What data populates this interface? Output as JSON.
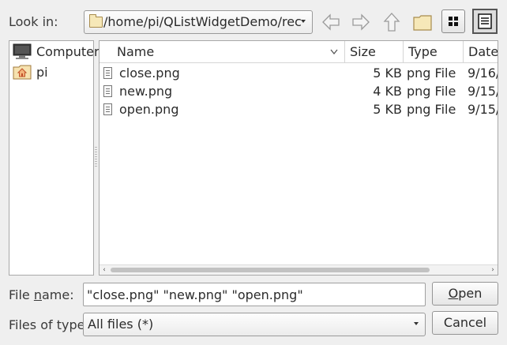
{
  "look_in": {
    "label": "Look in:",
    "path": "/home/pi/QListWidgetDemo/rec"
  },
  "toolbar": {
    "back_icon": "arrow-left-icon",
    "forward_icon": "arrow-right-icon",
    "parent_icon": "arrow-up-icon",
    "new_folder_icon": "new-folder-icon",
    "list_view_icon": "grid-icon",
    "detail_view_icon": "detail-list-icon"
  },
  "sidebar": {
    "items": [
      {
        "label": "Computer",
        "icon": "computer-icon"
      },
      {
        "label": "pi",
        "icon": "home-folder-icon"
      }
    ]
  },
  "file_list": {
    "columns": [
      "Name",
      "Size",
      "Type",
      "Date"
    ],
    "rows": [
      {
        "name": "close.png",
        "size": "5 KB",
        "type": "png File",
        "date": "9/16/"
      },
      {
        "name": "new.png",
        "size": "4 KB",
        "type": "png File",
        "date": "9/15/"
      },
      {
        "name": "open.png",
        "size": "5 KB",
        "type": "png File",
        "date": "9/15/"
      }
    ]
  },
  "file_name": {
    "label_pre": "File ",
    "label_mnemonic": "n",
    "label_post": "ame:",
    "value": "\"close.png\" \"new.png\" \"open.png\""
  },
  "file_type": {
    "label": "Files of type:",
    "value": "All files (*)"
  },
  "buttons": {
    "open_mnemonic": "O",
    "open_rest": "pen",
    "cancel": "Cancel"
  },
  "colors": {
    "background": "#efefef",
    "folder": "#f6e8b8",
    "home_folder": "#f2b27a"
  }
}
